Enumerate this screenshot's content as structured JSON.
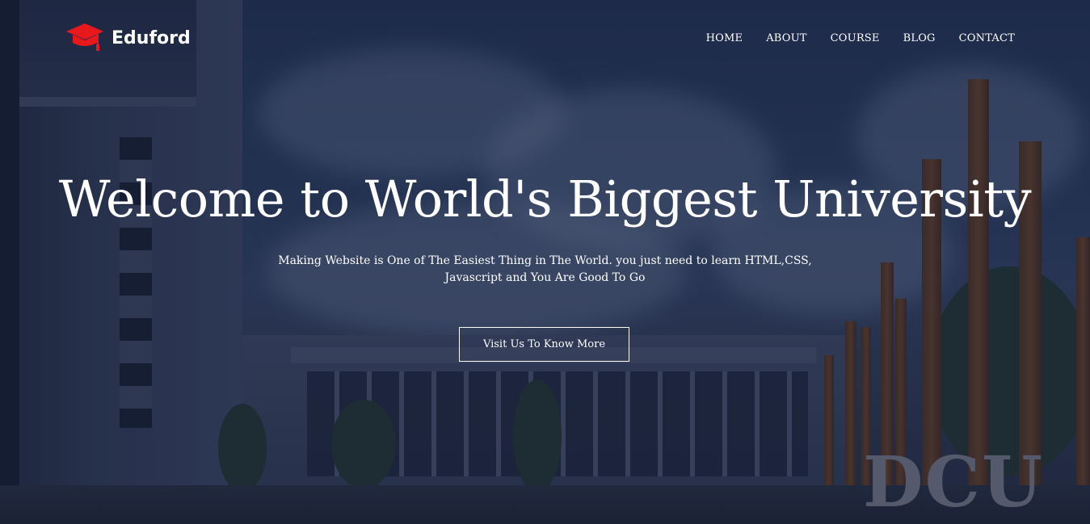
{
  "brand": {
    "name": "Eduford",
    "icon": "graduation-cap-icon",
    "icon_color": "#e8181d"
  },
  "nav": {
    "items": [
      {
        "label": "HOME"
      },
      {
        "label": "ABOUT"
      },
      {
        "label": "COURSE"
      },
      {
        "label": "BLOG"
      },
      {
        "label": "CONTACT"
      }
    ]
  },
  "hero": {
    "title": "Welcome to World's Biggest University",
    "subtitle_line1": "Making Website is One of The Easiest Thing in The World. you just need to learn HTML,CSS,",
    "subtitle_line2": "Javascript and You Are Good To Go",
    "cta_label": "Visit Us To Know More"
  },
  "background": {
    "sign_text": "DCU",
    "overlay_color": "#101832"
  }
}
